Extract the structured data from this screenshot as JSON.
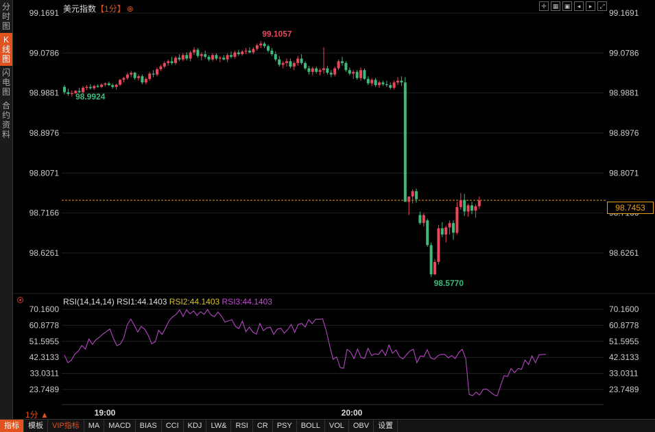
{
  "sidebar": {
    "tabs": [
      {
        "label": "分时图",
        "active": false
      },
      {
        "label": "K线图",
        "active": true
      },
      {
        "label": "闪电图",
        "active": false
      },
      {
        "label": "合约资料",
        "active": false
      }
    ]
  },
  "header": {
    "title": "美元指数",
    "period": "【1分】",
    "settings_icon": "⊕",
    "tool_icons": [
      "cross-icon",
      "zoom-icon",
      "fullscreen-icon",
      "prev-icon",
      "next-icon",
      "expand-icon"
    ]
  },
  "colors": {
    "up": "#e8485b",
    "down": "#3fba7c",
    "rsi1": "#c64bd6",
    "rsi2": "#d9c02a",
    "lastline": "#e5a020",
    "grid": "#222"
  },
  "chart_data": [
    {
      "type": "candlestick",
      "yticks": [
        "99.1691",
        "99.0786",
        "98.9881",
        "98.8976",
        "98.8071",
        "98.7166",
        "98.6261"
      ],
      "ylim": [
        98.59,
        99.1691
      ],
      "xticks": [
        "19:00",
        "20:00"
      ],
      "max_label": "99.1057",
      "min_label": "98.5770",
      "first_low_label": "98.9924",
      "last_price": "98.7453",
      "ohlc": [
        [
          99.002,
          99.006,
          98.985,
          98.99
        ],
        [
          98.99,
          98.998,
          98.982,
          98.986
        ],
        [
          98.986,
          98.994,
          98.98,
          98.988
        ],
        [
          98.988,
          98.995,
          98.986,
          98.993
        ],
        [
          98.993,
          99.0,
          98.988,
          98.99
        ],
        [
          98.99,
          99.004,
          98.986,
          99.0
        ],
        [
          99.0,
          99.006,
          98.995,
          99.002
        ],
        [
          99.002,
          99.008,
          98.996,
          98.999
        ],
        [
          98.999,
          99.006,
          98.995,
          99.004
        ],
        [
          99.004,
          99.008,
          99.0,
          99.002
        ],
        [
          99.002,
          99.01,
          98.999,
          99.007
        ],
        [
          99.007,
          99.012,
          99.003,
          99.01
        ],
        [
          99.01,
          99.014,
          99.004,
          99.006
        ],
        [
          99.006,
          99.01,
          98.998,
          99.002
        ],
        [
          99.002,
          99.009,
          98.996,
          99.007
        ],
        [
          99.007,
          99.02,
          99.004,
          99.018
        ],
        [
          99.018,
          99.025,
          99.012,
          99.022
        ],
        [
          99.022,
          99.034,
          99.018,
          99.03
        ],
        [
          99.03,
          99.038,
          99.024,
          99.034
        ],
        [
          99.034,
          99.036,
          99.018,
          99.022
        ],
        [
          99.022,
          99.03,
          99.016,
          99.026
        ],
        [
          99.026,
          99.03,
          99.008,
          99.012
        ],
        [
          99.012,
          99.024,
          99.008,
          99.02
        ],
        [
          99.02,
          99.036,
          99.016,
          99.032
        ],
        [
          99.032,
          99.04,
          99.024,
          99.03
        ],
        [
          99.03,
          99.046,
          99.026,
          99.042
        ],
        [
          99.042,
          99.052,
          99.038,
          99.048
        ],
        [
          99.048,
          99.06,
          99.044,
          99.056
        ],
        [
          99.056,
          99.064,
          99.05,
          99.06
        ],
        [
          99.06,
          99.07,
          99.052,
          99.056
        ],
        [
          99.056,
          99.072,
          99.052,
          99.068
        ],
        [
          99.068,
          99.076,
          99.06,
          99.064
        ],
        [
          99.064,
          99.078,
          99.06,
          99.074
        ],
        [
          99.074,
          99.08,
          99.062,
          99.066
        ],
        [
          99.066,
          99.084,
          99.06,
          99.08
        ],
        [
          99.08,
          99.092,
          99.074,
          99.086
        ],
        [
          99.086,
          99.09,
          99.068,
          99.072
        ],
        [
          99.072,
          99.08,
          99.062,
          99.076
        ],
        [
          99.076,
          99.084,
          99.066,
          99.07
        ],
        [
          99.07,
          99.074,
          99.06,
          99.064
        ],
        [
          99.064,
          99.078,
          99.06,
          99.074
        ],
        [
          99.074,
          99.078,
          99.062,
          99.066
        ],
        [
          99.066,
          99.072,
          99.058,
          99.068
        ],
        [
          99.068,
          99.074,
          99.062,
          99.064
        ],
        [
          99.064,
          99.078,
          99.058,
          99.074
        ],
        [
          99.074,
          99.082,
          99.066,
          99.07
        ],
        [
          99.07,
          99.084,
          99.066,
          99.08
        ],
        [
          99.08,
          99.086,
          99.072,
          99.076
        ],
        [
          99.076,
          99.086,
          99.072,
          99.082
        ],
        [
          99.082,
          99.09,
          99.076,
          99.084
        ],
        [
          99.084,
          99.092,
          99.078,
          99.08
        ],
        [
          99.08,
          99.092,
          99.076,
          99.088
        ],
        [
          99.088,
          99.1,
          99.084,
          99.096
        ],
        [
          99.096,
          99.106,
          99.09,
          99.1
        ],
        [
          99.1,
          99.104,
          99.09,
          99.094
        ],
        [
          99.094,
          99.098,
          99.08,
          99.084
        ],
        [
          99.084,
          99.09,
          99.072,
          99.076
        ],
        [
          99.076,
          99.082,
          99.06,
          99.064
        ],
        [
          99.064,
          99.072,
          99.048,
          99.052
        ],
        [
          99.052,
          99.06,
          99.044,
          99.056
        ],
        [
          99.056,
          99.066,
          99.048,
          99.06
        ],
        [
          99.06,
          99.066,
          99.044,
          99.048
        ],
        [
          99.048,
          99.06,
          99.04,
          99.056
        ],
        [
          99.056,
          99.072,
          99.05,
          99.066
        ],
        [
          99.066,
          99.076,
          99.052,
          99.056
        ],
        [
          99.056,
          99.06,
          99.04,
          99.044
        ],
        [
          99.044,
          99.05,
          99.03,
          99.036
        ],
        [
          99.036,
          99.048,
          99.028,
          99.044
        ],
        [
          99.044,
          99.048,
          99.032,
          99.036
        ],
        [
          99.036,
          99.044,
          99.028,
          99.04
        ],
        [
          99.04,
          99.092,
          99.032,
          99.044
        ],
        [
          99.044,
          99.05,
          99.03,
          99.034
        ],
        [
          99.034,
          99.04,
          99.024,
          99.03
        ],
        [
          99.03,
          99.048,
          99.026,
          99.044
        ],
        [
          99.044,
          99.064,
          99.04,
          99.06
        ],
        [
          99.06,
          99.07,
          99.05,
          99.056
        ],
        [
          99.056,
          99.06,
          99.036,
          99.04
        ],
        [
          99.04,
          99.046,
          99.028,
          99.032
        ],
        [
          99.032,
          99.04,
          99.02,
          99.036
        ],
        [
          99.036,
          99.04,
          99.018,
          99.022
        ],
        [
          99.022,
          99.046,
          99.016,
          99.04
        ],
        [
          99.04,
          99.044,
          99.018,
          99.02
        ],
        [
          99.02,
          99.026,
          99.006,
          99.01
        ],
        [
          99.01,
          99.022,
          99.004,
          99.018
        ],
        [
          99.018,
          99.022,
          99.002,
          99.006
        ],
        [
          99.006,
          99.016,
          99.0,
          99.012
        ],
        [
          99.012,
          99.016,
          99.004,
          99.008
        ],
        [
          99.008,
          99.016,
          99.002,
          99.006
        ],
        [
          99.006,
          99.012,
          98.996,
          99.0
        ],
        [
          99.0,
          99.016,
          98.996,
          99.012
        ],
        [
          99.012,
          99.024,
          99.006,
          99.016
        ],
        [
          99.016,
          99.026,
          99.004,
          99.012
        ],
        [
          99.012,
          99.024,
          98.748,
          98.742
        ],
        [
          98.742,
          98.748,
          98.712,
          98.754
        ],
        [
          98.754,
          98.77,
          98.738,
          98.766
        ],
        [
          98.766,
          98.772,
          98.74,
          98.748
        ],
        [
          98.712,
          98.72,
          98.69,
          98.694
        ],
        [
          98.694,
          98.716,
          98.686,
          98.712
        ],
        [
          98.7,
          98.704,
          98.64,
          98.644
        ],
        [
          98.644,
          98.65,
          98.572,
          98.578
        ],
        [
          98.578,
          98.612,
          98.576,
          98.606
        ],
        [
          98.606,
          98.69,
          98.6,
          98.682
        ],
        [
          98.682,
          98.696,
          98.662,
          98.668
        ],
        [
          98.668,
          98.688,
          98.65,
          98.684
        ],
        [
          98.684,
          98.7,
          98.668,
          98.694
        ],
        [
          98.694,
          98.7,
          98.656,
          98.672
        ],
        [
          98.672,
          98.742,
          98.668,
          98.73
        ],
        [
          98.73,
          98.762,
          98.724,
          98.746
        ],
        [
          98.746,
          98.76,
          98.71,
          98.72
        ],
        [
          98.72,
          98.738,
          98.708,
          98.734
        ],
        [
          98.734,
          98.742,
          98.714,
          98.722
        ],
        [
          98.722,
          98.736,
          98.706,
          98.732
        ],
        [
          98.732,
          98.754,
          98.726,
          98.745
        ]
      ]
    },
    {
      "type": "line",
      "indicator": "RSI",
      "legend": {
        "params": "RSI(14,14,14)",
        "rsi1": "RSI1:44.1403",
        "rsi2": "RSI2:44.1403",
        "rsi3": "RSI3:44.1403"
      },
      "yticks": [
        "70.1600",
        "60.8778",
        "51.5955",
        "42.3133",
        "33.0311",
        "23.7489"
      ],
      "ylim": [
        19.5,
        72
      ],
      "values": [
        43.5,
        39.2,
        40.8,
        44.3,
        46.0,
        49.2,
        47.1,
        53.0,
        49.8,
        52.5,
        54.0,
        55.8,
        57.2,
        58.8,
        53.5,
        49.1,
        50.0,
        53.6,
        61.2,
        64.5,
        61.0,
        57.0,
        60.2,
        58.6,
        55.1,
        50.2,
        51.3,
        58.0,
        55.6,
        59.5,
        63.5,
        65.8,
        67.2,
        69.8,
        66.0,
        69.8,
        67.5,
        69.2,
        66.5,
        68.8,
        67.2,
        70.0,
        66.8,
        65.9,
        68.5,
        66.2,
        62.8,
        63.5,
        64.1,
        60.2,
        59.0,
        63.3,
        57.2,
        59.8,
        57.0,
        55.7,
        62.0,
        57.8,
        59.4,
        59.8,
        55.6,
        58.6,
        59.2,
        56.4,
        58.4,
        61.4,
        56.8,
        61.4,
        62.0,
        59.9,
        64.2,
        61.8,
        64.4,
        64.4,
        64.6,
        58.0,
        49.2,
        41.2,
        42.6,
        36.5,
        36.0,
        47.0,
        45.4,
        41.6,
        47.1,
        42.3,
        41.7,
        47.6,
        43.4,
        44.4,
        44.0,
        46.7,
        43.4,
        49.5,
        44.7,
        46.6,
        42.9,
        41.4,
        43.8,
        46.0,
        47.0,
        39.2,
        43.2,
        42.8,
        46.7,
        42.0,
        41.2,
        43.2,
        44.1,
        44.0,
        42.1,
        43.4,
        41.6,
        45.1,
        47.0,
        41.7,
        20.8,
        20.2,
        22.3,
        20.5,
        23.8,
        24.0,
        22.4,
        20.8,
        20.0,
        26.0,
        31.8,
        31.3,
        35.8,
        33.5,
        35.9,
        35.4,
        40.8,
        38.2,
        43.2,
        39.2,
        43.8,
        44.0,
        44.1
      ]
    }
  ],
  "bottombar": {
    "period_label": "1分 ▲",
    "tabs": [
      "指标",
      "模板",
      "VIP指标",
      "MA",
      "MACD",
      "BIAS",
      "CCI",
      "KDJ",
      "LW&",
      "RSI",
      "CR",
      "PSY",
      "BOLL",
      "VOL",
      "OBV",
      "设置"
    ]
  }
}
